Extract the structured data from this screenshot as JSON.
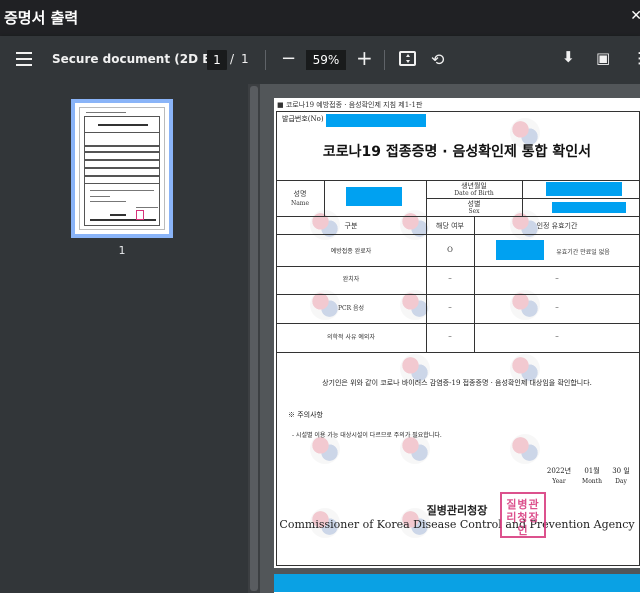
{
  "window": {
    "title": "증명서 출력",
    "close_icon": "close-icon"
  },
  "toolbar": {
    "menu_icon": "menu-icon",
    "filename": "Secure document (2D B...",
    "page_current": "1",
    "page_separator": "/",
    "page_total": "1",
    "zoom_out_label": "−",
    "zoom_value": "59%",
    "zoom_in_label": "+",
    "fit_icon": "fit-page-icon",
    "rotate_icon": "rotate-icon",
    "download_icon": "download-icon",
    "print_icon": "print-icon",
    "more_icon": "more-vert-icon"
  },
  "sidebar": {
    "thumbnails": [
      {
        "page_label": "1"
      }
    ]
  },
  "document": {
    "top_label": "■ 코로나19 예방접종 · 음성확인제 지침 제1-1판",
    "issue_no_label": "발급번호(No)",
    "title": "코로나19 접종증명 · 음성확인제 통합 확인서",
    "name_ko": "성명",
    "name_en": "Name",
    "dob_ko": "생년월일",
    "dob_en": "Date of Birth",
    "sex_ko": "성별",
    "sex_en": "Sex",
    "header_category": "구분",
    "header_applicable": "해당 여부",
    "header_validity": "인정 유효기간",
    "rows": [
      {
        "category": "예방접종 완료자",
        "applicable": "O",
        "validity": "유효기간 만료일 없음"
      },
      {
        "category": "완치자",
        "applicable": "–",
        "validity": "–"
      },
      {
        "category": "PCR 음성",
        "applicable": "–",
        "validity": "–"
      },
      {
        "category": "의학적 사유 예외자",
        "applicable": "–",
        "validity": "–"
      }
    ],
    "certify_text": "상기인은 위와 같이 코로나 바이러스 감염증-19 접종증명 · 음성확인제 대상임을 확인합니다.",
    "notice_heading": "※ 주의사항",
    "notice_text": "- 시설별 이용 가능 대상시설이 다르므로 주의가 필요합니다.",
    "date": {
      "year": "2022년",
      "month": "01월",
      "day": "30 일",
      "year_en": "Year",
      "month_en": "Month",
      "day_en": "Day"
    },
    "agency_ko": "질병관리청장",
    "agency_en": "Commissioner of Korea Disease Control and Prevention Agency",
    "seal_text": "질병관리청장인",
    "redaction_color": "#00a1f1"
  }
}
